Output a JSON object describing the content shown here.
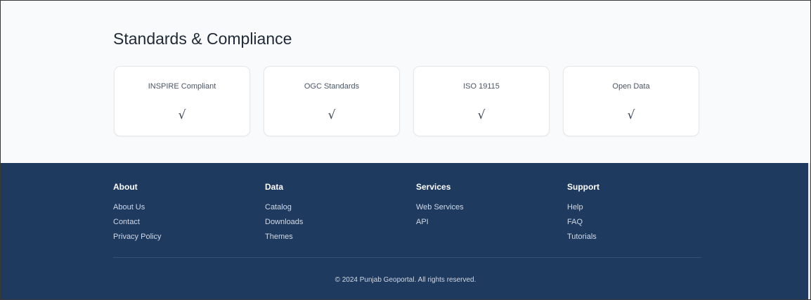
{
  "standards": {
    "title": "Standards & Compliance",
    "cards": [
      {
        "label": "INSPIRE Compliant",
        "check": "√"
      },
      {
        "label": "OGC Standards",
        "check": "√"
      },
      {
        "label": "ISO 19115",
        "check": "√"
      },
      {
        "label": "Open Data",
        "check": "√"
      }
    ]
  },
  "footer": {
    "columns": [
      {
        "heading": "About",
        "links": [
          "About Us",
          "Contact",
          "Privacy Policy"
        ]
      },
      {
        "heading": "Data",
        "links": [
          "Catalog",
          "Downloads",
          "Themes"
        ]
      },
      {
        "heading": "Services",
        "links": [
          "Web Services",
          "API"
        ]
      },
      {
        "heading": "Support",
        "links": [
          "Help",
          "FAQ",
          "Tutorials"
        ]
      }
    ],
    "copyright": "© 2024 Punjab Geoportal. All rights reserved."
  },
  "colors": {
    "footer_bg": "#1e3a5f",
    "section_bg": "#f9fafb",
    "card_bg": "#ffffff"
  }
}
